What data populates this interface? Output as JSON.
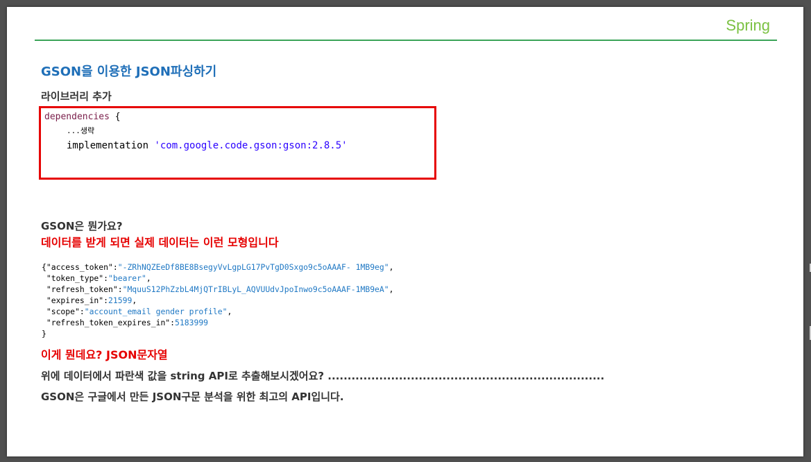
{
  "header": {
    "brand": "Spring"
  },
  "title": "GSON을 이용한 JSON파싱하기",
  "library_section": {
    "label": "라이브러리 추가",
    "code": {
      "keyword": "dependencies",
      "brace_open": " {",
      "omitted": "...생략",
      "impl_keyword": "implementation ",
      "impl_value": "'com.google.code.gson:gson:2.8.5'"
    }
  },
  "question": "GSON은 뭔가요?",
  "explain": "데이터를 받게 되면 실제 데이터는 이런 모형입니다",
  "json_example": {
    "open": "{",
    "rows": [
      {
        "key": "\"access_token\":",
        "value": "\"-ZRhNQZEeDf8BE8BsegyVvLgpLG17PvTgD0Sxgo9c5oAAAF- 1MB9eg\"",
        "suffix": ","
      },
      {
        "key": " \"token_type\":",
        "value": "\"bearer\"",
        "suffix": ","
      },
      {
        "key": " \"refresh_token\":",
        "value": "\"MquuS12PhZzbL4MjQTrIBLyL_AQVUUdvJpoInwo9c5oAAAF-1MB9eA\"",
        "suffix": ","
      },
      {
        "key": " \"expires_in\":",
        "value": "21599",
        "suffix": ","
      },
      {
        "key": " \"scope\":",
        "value": "\"account_email gender profile\"",
        "suffix": ","
      },
      {
        "key": " \"refresh_token_expires_in\":",
        "value": "5183999",
        "suffix": ""
      }
    ],
    "close": "}"
  },
  "json_caption": "이게 뭔데요? JSON문자열",
  "lines": {
    "task": "위에 데이터에서 파란색 값을 string API로 추출해보시겠어요? ......................................................................",
    "summary": "GSON은 구글에서 만든 JSON구문 분석을 위한 최고의 API입니다."
  },
  "colors": {
    "brand": "#7bc142",
    "rule": "#3aa357",
    "title": "#1f6fb8",
    "highlight": "#e60000",
    "json_value": "#1f78c4"
  }
}
